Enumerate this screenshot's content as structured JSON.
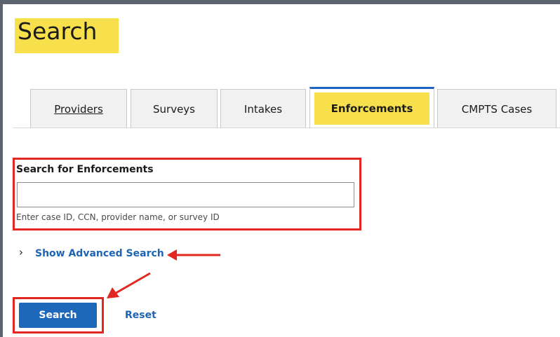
{
  "page": {
    "title": "Search"
  },
  "tabs": [
    {
      "label": "Providers",
      "selected": false
    },
    {
      "label": "Surveys",
      "selected": false
    },
    {
      "label": "Intakes",
      "selected": false
    },
    {
      "label": "Enforcements",
      "selected": true
    },
    {
      "label": "CMPTS Cases",
      "selected": false
    }
  ],
  "search": {
    "label": "Search for Enforcements",
    "value": "",
    "placeholder": "",
    "helper": "Enter case ID, CCN, provider name, or survey ID"
  },
  "advanced": {
    "label": "Show Advanced Search",
    "expanded": false
  },
  "buttons": {
    "search": "Search",
    "reset": "Reset"
  },
  "colors": {
    "highlight": "#f7e04b",
    "primary": "#1d68b9",
    "link": "#1e64b4",
    "annotation": "#e3261f",
    "tab_active_border": "#2064c2"
  },
  "icons": {
    "advanced_toggle": "chevron-right-icon",
    "annotation": "red-arrow-icon"
  }
}
